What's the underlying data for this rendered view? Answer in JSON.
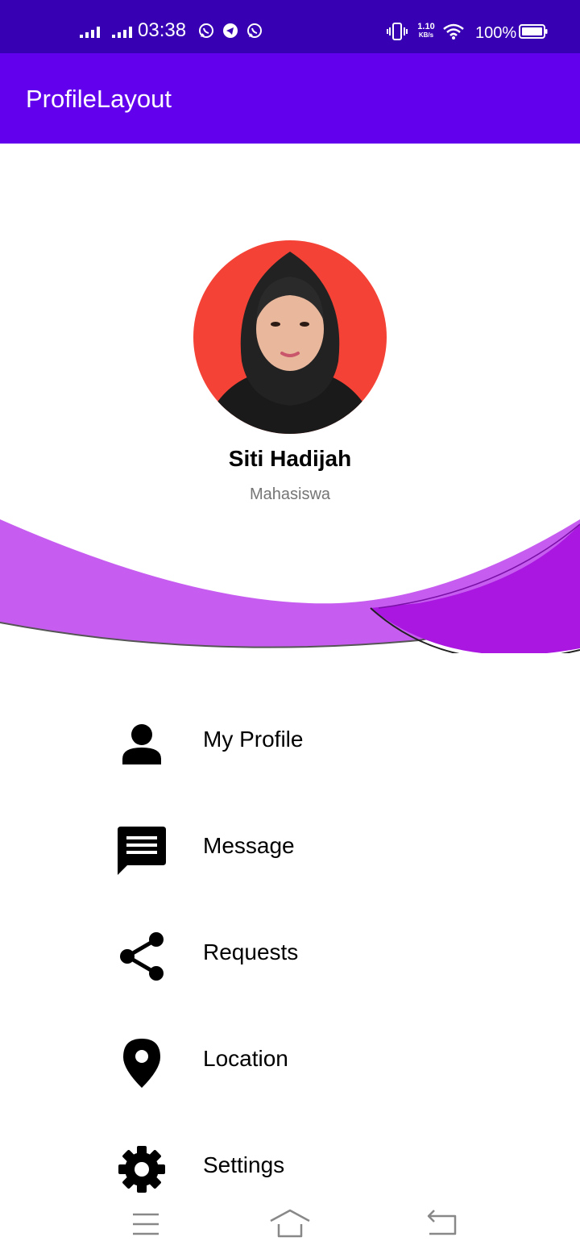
{
  "status_bar": {
    "time": "03:38",
    "speed_value": "1.10",
    "speed_unit": "KB/s",
    "battery": "100%",
    "icons": [
      "signal-icon",
      "signal-icon",
      "whatsapp-icon",
      "telegram-icon",
      "whatsapp-icon",
      "vibrate-icon",
      "wifi-icon",
      "battery-icon"
    ]
  },
  "app_bar": {
    "title": "ProfileLayout"
  },
  "profile": {
    "name": "Siti Hadijah",
    "role": "Mahasiswa"
  },
  "menu": {
    "items": [
      {
        "label": "My Profile",
        "icon": "person-icon"
      },
      {
        "label": "Message",
        "icon": "message-icon"
      },
      {
        "label": "Requests",
        "icon": "share-icon"
      },
      {
        "label": "Location",
        "icon": "location-pin-icon"
      },
      {
        "label": "Settings",
        "icon": "gear-icon"
      }
    ]
  },
  "nav_bar": {
    "icons": [
      "menu-icon",
      "home-icon",
      "back-icon"
    ]
  },
  "colors": {
    "status_bar": "#3700b3",
    "app_bar": "#6200ee",
    "avatar_bg": "#f44336",
    "wave_light": "#c75df0",
    "wave_dark": "#a917e0",
    "role_text": "#757575"
  }
}
